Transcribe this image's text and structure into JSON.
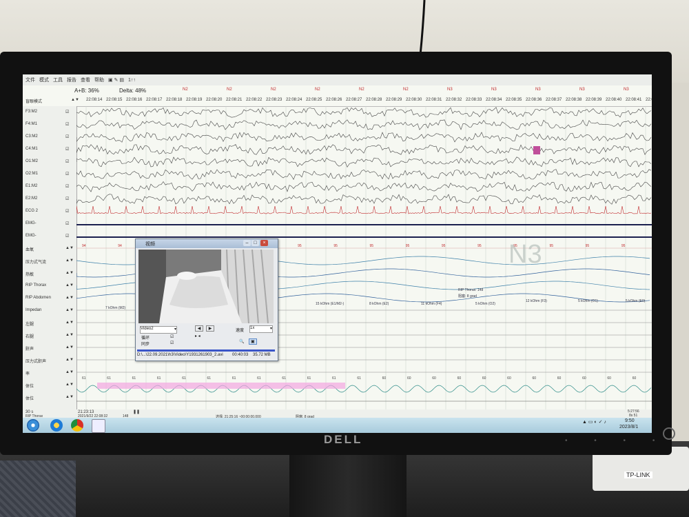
{
  "menu": [
    "文件",
    "模式",
    "工具",
    "报告",
    "查看",
    "帮助"
  ],
  "toolbar_extra": "1↑↑",
  "ratio_ab": "A+B: 36%",
  "delta": "Delta: 48%",
  "mode_label": "盲眼模式",
  "times": [
    "22:08:14",
    "22:08:15",
    "22:08:16",
    "22:08:17",
    "22:08:18",
    "22:08:19",
    "22:08:20",
    "22:08:21",
    "22:08:22",
    "22:08:23",
    "22:08:24",
    "22:08:25",
    "22:08:26",
    "22:08:27",
    "22:08:28",
    "22:08:29",
    "22:08:30",
    "22:08:31",
    "22:08:32",
    "22:08:33",
    "22:08:34",
    "22:08:35",
    "22:08:36",
    "22:08:37",
    "22:08:38",
    "22:08:39",
    "22:08:40",
    "22:08:41",
    "22:08:42"
  ],
  "stages": [
    "N2",
    "N2",
    "N2",
    "N2",
    "N2",
    "N2",
    "N3",
    "N3",
    "N3",
    "N3",
    "N3"
  ],
  "channels": [
    "F3:M2",
    "F4:M1",
    "C3:M2",
    "C4:M1",
    "O1:M2",
    "O2:M1",
    "E1:M2",
    "E2:M2",
    "ECG 2",
    "EMG-",
    "EMG-",
    "血氧",
    "压力式气流",
    "热敏",
    "RIP Thorax",
    "RIP Abdomen",
    "Impedan",
    "左腿",
    "右腿",
    "鼾声",
    "压力式鼾声",
    "率",
    "体位",
    "体位"
  ],
  "big_stage": "N3",
  "impedance_labels": [
    "7 kOhm (M2)",
    "15 kOhm (E1/M2-)",
    "8 kOhm (E2)",
    "11 kOhm (F4)",
    "5 kOhm (O2)",
    "RIP Thorax: 148",
    "阻塞: 8 grad",
    "12 kOhm (F3)",
    "5 kOhm (O1)",
    "5 kOhm (E0)"
  ],
  "spo2_values": [
    "94",
    "94",
    "94",
    "95",
    "95",
    "95",
    "95",
    "95",
    "95",
    "95",
    "95",
    "95",
    "95",
    "95",
    "95",
    "95"
  ],
  "hr_values": [
    "61",
    "61",
    "61",
    "61",
    "61",
    "61",
    "61",
    "61",
    "61",
    "61",
    "61",
    "61",
    "60",
    "60",
    "60",
    "60",
    "60",
    "60",
    "60",
    "60",
    "60",
    "60",
    "60"
  ],
  "video_window": {
    "title": "视频",
    "source": "Video2",
    "loop": "循环",
    "sync": "同步",
    "speed_label": "速度",
    "speed": "1x",
    "path": "D:\\...\\22.09.2021\\h3\\Video\\Y1931261903_2.avi",
    "time": "00:40:03",
    "size": "35.72 MB"
  },
  "bottom": {
    "left1": "30 s",
    "left2": "RIP Thorax",
    "time_left": "21:23:13",
    "date": "2021/9/22 22:08:32",
    "val": "148",
    "selection": "选择: 21:25:16 ~00:00:00.000",
    "block": "阻塞: 8 grad",
    "right_time": "5:27:56",
    "right2": "8s 51"
  },
  "tray": {
    "time": "9:50",
    "date": "2023/8/1"
  },
  "brand": "DELL",
  "router": "TP-LINK"
}
